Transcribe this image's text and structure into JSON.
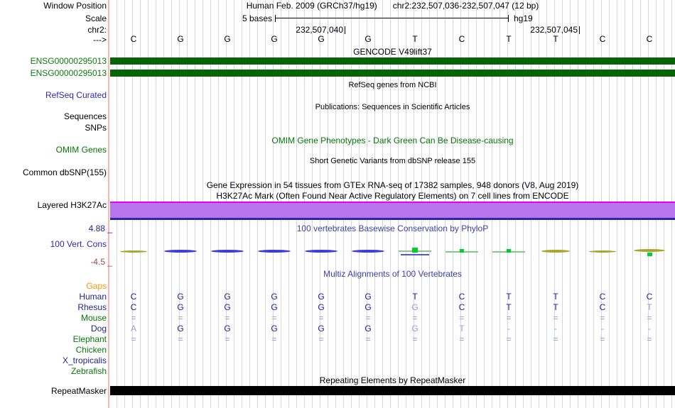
{
  "header": {
    "window_position_label": "Window Position",
    "scale_row_label": "Scale",
    "chrom_label": "chr2:",
    "strand_arrow": "--->",
    "assembly_title": "Human Feb. 2009 (GRCh37/hg19)",
    "position_title": "chr2:232,507,036-232,507,047 (12 bp)",
    "scale_label": "5 bases",
    "assembly_tag": "hg19",
    "ruler_ticks": [
      {
        "label": "232,507,040",
        "col": 5
      },
      {
        "label": "232,507,045",
        "col": 10
      }
    ],
    "bases": [
      "C",
      "G",
      "G",
      "G",
      "G",
      "G",
      "T",
      "C",
      "T",
      "T",
      "C",
      "C"
    ]
  },
  "tracks": {
    "gencode": {
      "title": "GENCODE V49lift37",
      "items": [
        {
          "label": "ENSG00000295013"
        },
        {
          "label": "ENSG00000295013"
        }
      ]
    },
    "refseq": {
      "title": "RefSeq genes from NCBI",
      "label": "RefSeq Curated"
    },
    "publications": {
      "title": "Publications: Sequences in Scientific Articles"
    },
    "sequences_label": "Sequences",
    "snps_label": "SNPs",
    "omim": {
      "title": "OMIM Gene Phenotypes - Dark Green Can Be Disease-causing",
      "label": "OMIM Genes"
    },
    "dbsnp": {
      "title": "Short Genetic Variants from dbSNP release 155",
      "label": "Common dbSNP(155)"
    },
    "gtex": {
      "title": "Gene Expression in 54 tissues from GTEx RNA-seq of 17382 samples, 948 donors (V8, Aug 2019)"
    },
    "h3k27ac": {
      "title": "H3K27Ac Mark (Often Found Near Active Regulatory Elements) on 7 cell lines from ENCODE",
      "label": "Layered H3K27Ac"
    },
    "phylop": {
      "title": "100 vertebrates Basewise Conservation by PhyloP",
      "label": "100 Vert. Cons",
      "max_label": "4.88 _",
      "min_label": "-4.5 _",
      "marks": [
        {
          "col": 1,
          "type": "olive"
        },
        {
          "col": 2,
          "type": "blue"
        },
        {
          "col": 3,
          "type": "blue"
        },
        {
          "col": 4,
          "type": "blue"
        },
        {
          "col": 5,
          "type": "blue"
        },
        {
          "col": 6,
          "type": "blue"
        },
        {
          "col": 7,
          "type": "green_square_blue"
        },
        {
          "col": 8,
          "type": "pale_square"
        },
        {
          "col": 9,
          "type": "pale_square"
        },
        {
          "col": 10,
          "type": "olive_thick"
        },
        {
          "col": 11,
          "type": "olive"
        },
        {
          "col": 12,
          "type": "olive_square_below"
        }
      ]
    },
    "multiz": {
      "title": "Multiz Alignments of 100 Vertebrates",
      "species": [
        {
          "name": "Gaps",
          "color": "#f8980a",
          "cells": []
        },
        {
          "name": "Human",
          "color": "#22258c",
          "cells": [
            {
              "t": "C",
              "s": "d"
            },
            {
              "t": "G",
              "s": "d"
            },
            {
              "t": "G",
              "s": "d"
            },
            {
              "t": "G",
              "s": "d"
            },
            {
              "t": "G",
              "s": "d"
            },
            {
              "t": "G",
              "s": "d"
            },
            {
              "t": "T",
              "s": "d"
            },
            {
              "t": "C",
              "s": "d"
            },
            {
              "t": "T",
              "s": "d"
            },
            {
              "t": "T",
              "s": "d"
            },
            {
              "t": "C",
              "s": "d"
            },
            {
              "t": "C",
              "s": "d"
            }
          ]
        },
        {
          "name": "Rhesus",
          "color": "#22258c",
          "cells": [
            {
              "t": "C",
              "s": "d"
            },
            {
              "t": "G",
              "s": "d"
            },
            {
              "t": "G",
              "s": "d"
            },
            {
              "t": "G",
              "s": "d"
            },
            {
              "t": "G",
              "s": "d"
            },
            {
              "t": "G",
              "s": "d"
            },
            {
              "t": "G",
              "s": "l"
            },
            {
              "t": "C",
              "s": "d"
            },
            {
              "t": "T",
              "s": "d"
            },
            {
              "t": "T",
              "s": "d"
            },
            {
              "t": "C",
              "s": "d"
            },
            {
              "t": "T",
              "s": "l"
            }
          ]
        },
        {
          "name": "Mouse",
          "color": "#067806",
          "cells": [
            {
              "t": "=",
              "s": "l"
            },
            {
              "t": "=",
              "s": "l"
            },
            {
              "t": "=",
              "s": "l"
            },
            {
              "t": "=",
              "s": "l"
            },
            {
              "t": "=",
              "s": "l"
            },
            {
              "t": "=",
              "s": "l"
            },
            {
              "t": "=",
              "s": "l"
            },
            {
              "t": "=",
              "s": "l"
            },
            {
              "t": "=",
              "s": "l"
            },
            {
              "t": "=",
              "s": "l"
            },
            {
              "t": "=",
              "s": "l"
            },
            {
              "t": "=",
              "s": "l"
            }
          ]
        },
        {
          "name": "Dog",
          "color": "#22258c",
          "cells": [
            {
              "t": "A",
              "s": "l"
            },
            {
              "t": "G",
              "s": "d"
            },
            {
              "t": "G",
              "s": "d"
            },
            {
              "t": "G",
              "s": "d"
            },
            {
              "t": "G",
              "s": "d"
            },
            {
              "t": "G",
              "s": "d"
            },
            {
              "t": "G",
              "s": "l"
            },
            {
              "t": "T",
              "s": "l"
            },
            {
              "t": "-",
              "s": "l"
            },
            {
              "t": "-",
              "s": "l"
            },
            {
              "t": "-",
              "s": "l"
            },
            {
              "t": "-",
              "s": "l"
            }
          ]
        },
        {
          "name": "Elephant",
          "color": "#067806",
          "cells": [
            {
              "t": "=",
              "s": "l"
            },
            {
              "t": "=",
              "s": "l"
            },
            {
              "t": "=",
              "s": "l"
            },
            {
              "t": "=",
              "s": "l"
            },
            {
              "t": "=",
              "s": "l"
            },
            {
              "t": "=",
              "s": "l"
            },
            {
              "t": "=",
              "s": "l"
            },
            {
              "t": "=",
              "s": "l"
            },
            {
              "t": "=",
              "s": "l"
            },
            {
              "t": "=",
              "s": "l"
            },
            {
              "t": "=",
              "s": "l"
            },
            {
              "t": "=",
              "s": "l"
            }
          ]
        },
        {
          "name": "Chicken",
          "color": "#067806",
          "cells": []
        },
        {
          "name": "X_tropicalis",
          "color": "#22258c",
          "cells": []
        },
        {
          "name": "Zebrafish",
          "color": "#067806",
          "cells": []
        }
      ]
    },
    "repeatmasker": {
      "title": "Repeating Elements by RepeatMasker",
      "label": "RepeatMasker"
    }
  },
  "colors": {
    "track_green": "#066406",
    "gene_label_green": "#0b7d0b",
    "h3k_fill": "#b973ec",
    "h3k_top": "#e800e8",
    "h3k_bottom": "#2828a0",
    "mark_olive": "#a8a828",
    "mark_blue": "#3c3cd8",
    "mark_pale_green": "#86c986",
    "mark_bright_green": "#00cc33",
    "mark_subline_blue": "#5555cc",
    "cell_dark": "#1d1d92",
    "cell_light": "#9a9ad0"
  }
}
